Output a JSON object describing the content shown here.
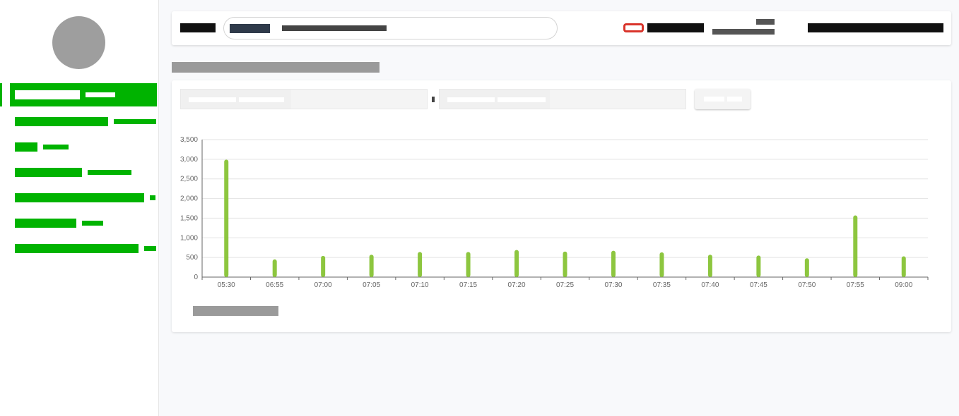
{
  "colors": {
    "accent": "#00b300",
    "bar": "#8dc63f",
    "alert": "#d9342b"
  },
  "chart_data": {
    "type": "bar",
    "categories": [
      "05:30",
      "06:55",
      "07:00",
      "07:05",
      "07:10",
      "07:15",
      "07:20",
      "07:25",
      "07:30",
      "07:35",
      "07:40",
      "07:45",
      "07:50",
      "07:55",
      "09:00"
    ],
    "values": [
      2990,
      450,
      540,
      570,
      640,
      640,
      690,
      650,
      670,
      630,
      570,
      550,
      480,
      1570,
      530
    ],
    "ylim": [
      0,
      3500
    ],
    "yticks": [
      "0",
      "500",
      "1,000",
      "1,500",
      "2,000",
      "2,500",
      "3,000",
      "3,500"
    ],
    "grid": true
  }
}
